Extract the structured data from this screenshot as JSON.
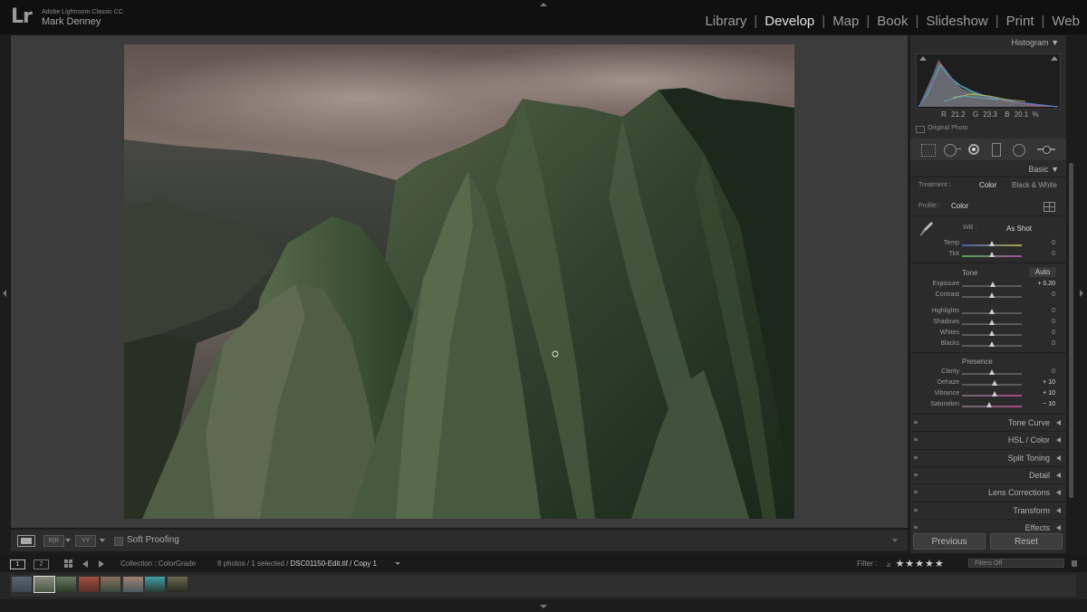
{
  "app": {
    "logo": "Lr",
    "name": "Adobe Lightroom Classic CC",
    "user": "Mark Denney"
  },
  "modules": [
    "Library",
    "Develop",
    "Map",
    "Book",
    "Slideshow",
    "Print",
    "Web"
  ],
  "active_module": "Develop",
  "toolbar": {
    "soft_proofing": "Soft Proofing",
    "view_compare": "YY"
  },
  "panel": {
    "histogram": {
      "title": "Histogram",
      "r_label": "R",
      "r_value": "21.2",
      "g_label": "G",
      "g_value": "23.3",
      "b_label": "B",
      "b_value": "20.1",
      "unit": "%",
      "original_photo": "Original Photo"
    },
    "basic": {
      "title": "Basic",
      "treatment_label": "Treatment :",
      "treatment_color": "Color",
      "treatment_bw": "Black & White",
      "profile_label": "Profile :",
      "profile_value": "Color",
      "wb_label": "WB :",
      "wb_value": "As Shot",
      "tone_label": "Tone",
      "auto_label": "Auto",
      "presence_label": "Presence",
      "wb_sliders": [
        {
          "label": "Temp",
          "value": "0",
          "pos": 0.5
        },
        {
          "label": "Tint",
          "value": "0",
          "pos": 0.5
        }
      ],
      "tone_sliders": [
        {
          "label": "Exposure",
          "value": "+ 0.20",
          "pos": 0.52
        },
        {
          "label": "Contrast",
          "value": "0",
          "pos": 0.5
        }
      ],
      "tone_sliders2": [
        {
          "label": "Highlights",
          "value": "0",
          "pos": 0.5
        },
        {
          "label": "Shadows",
          "value": "0",
          "pos": 0.5
        },
        {
          "label": "Whites",
          "value": "0",
          "pos": 0.5
        },
        {
          "label": "Blacks",
          "value": "0",
          "pos": 0.5
        }
      ],
      "presence_sliders": [
        {
          "label": "Clarity",
          "value": "0",
          "pos": 0.5
        },
        {
          "label": "Dehaze",
          "value": "+ 10",
          "pos": 0.55
        },
        {
          "label": "Vibrance",
          "value": "+ 10",
          "pos": 0.55
        },
        {
          "label": "Saturation",
          "value": "− 10",
          "pos": 0.45
        }
      ]
    },
    "collapsed_panels": [
      "Tone Curve",
      "HSL / Color",
      "Split Toning",
      "Detail",
      "Lens Corrections",
      "Transform",
      "Effects"
    ],
    "previous_button": "Previous",
    "reset_button": "Reset"
  },
  "filmstrip": {
    "page1": "1",
    "page2": "2",
    "collection_prefix": "Collection : ColorGrade",
    "count_text": "8 photos / 1 selected / ",
    "filename": "DSC01150-Edit.tif / Copy 1",
    "filter_label": "Filter :",
    "filters_off": "Filters Off",
    "thumb_count": 8
  }
}
